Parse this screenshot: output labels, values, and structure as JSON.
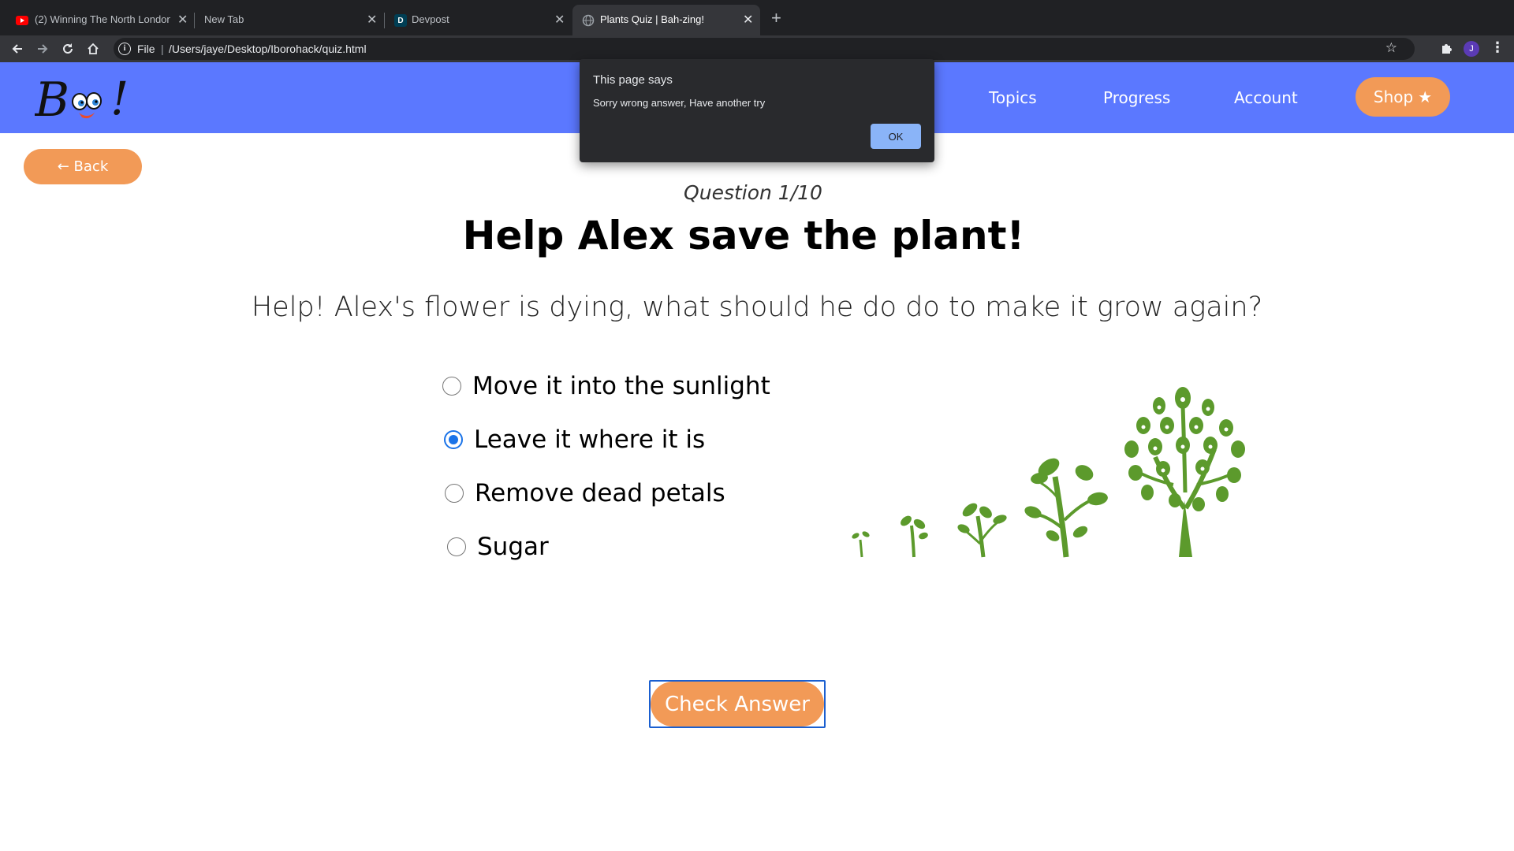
{
  "browser": {
    "tabs": [
      {
        "title": "(2) Winning The North London",
        "favicon": "youtube-icon",
        "active": false
      },
      {
        "title": "New Tab",
        "favicon": "",
        "active": false
      },
      {
        "title": "Devpost",
        "favicon": "devpost-icon",
        "favicon_letter": "D",
        "active": false
      },
      {
        "title": "Plants Quiz | Bah-zing!",
        "favicon": "globe-icon",
        "active": true
      }
    ],
    "address": {
      "scheme": "File",
      "url": "/Users/jaye/Desktop/Iborohack/quiz.html"
    },
    "profile_initial": "J"
  },
  "header": {
    "logo_text": "Bo!",
    "nav": [
      "Topics",
      "Progress",
      "Account"
    ],
    "shop_label": "Shop",
    "accent_color": "#5b78ff",
    "button_color": "#f29a57"
  },
  "back_label": "← Back",
  "quiz": {
    "counter": "Question 1/10",
    "title": "Help Alex save the plant!",
    "question": "Help! Alex's flower is dying, what should he do do to make it grow again?",
    "options": [
      {
        "label": "Move it into the sunlight",
        "checked": false
      },
      {
        "label": "Leave it where it is",
        "checked": true
      },
      {
        "label": "Remove dead petals",
        "checked": false
      },
      {
        "label": "Sugar",
        "checked": false
      }
    ],
    "check_label": "Check Answer"
  },
  "alert": {
    "title": "This page says",
    "message": "Sorry wrong answer, Have another try",
    "ok_label": "OK"
  }
}
